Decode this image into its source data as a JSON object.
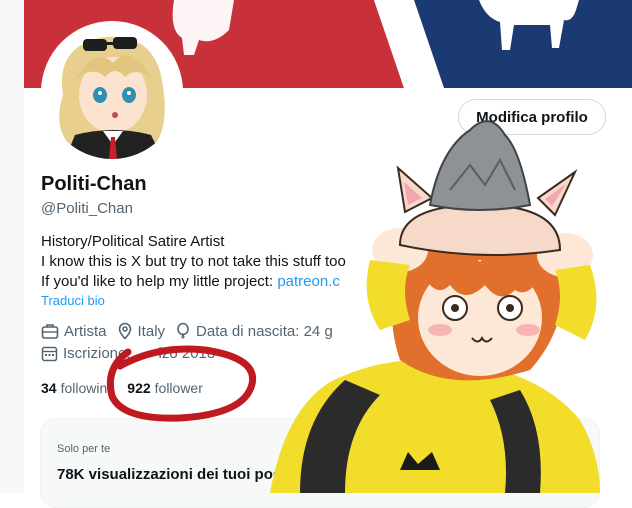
{
  "profile": {
    "name": "Politi-Chan",
    "handle": "@Politi_Chan",
    "bio_line1": "History/Political Satire Artist",
    "bio_line2": "I know this is X but try to not take this stuff too",
    "bio_line3_prefix": "If you'd like to help my little project: ",
    "bio_line3_link": "patreon.c",
    "translate_label": "Traduci bio",
    "edit_button": "Modifica profilo"
  },
  "meta": {
    "category": "Artista",
    "location": "Italy",
    "birth": "Data di nascita: 24 g",
    "joined_prefix": "Iscrizione:",
    "joined_date": "izo 2018"
  },
  "stats": {
    "following_count": "34",
    "following_label": "followin",
    "followers_count": "922",
    "followers_label": "follower"
  },
  "card": {
    "label": "Solo per te",
    "title": "78K visualizzazioni dei tuoi pos"
  },
  "colors": {
    "banner_red": "#c8313a",
    "banner_blue": "#1b3a73",
    "link_blue": "#1d9bf0",
    "annotation_red": "#c0191f",
    "character_shirt": "#f2dd2a"
  },
  "icons": {
    "category": "briefcase-icon",
    "location": "location-pin-icon",
    "birth": "balloon-icon",
    "joined": "calendar-icon"
  }
}
